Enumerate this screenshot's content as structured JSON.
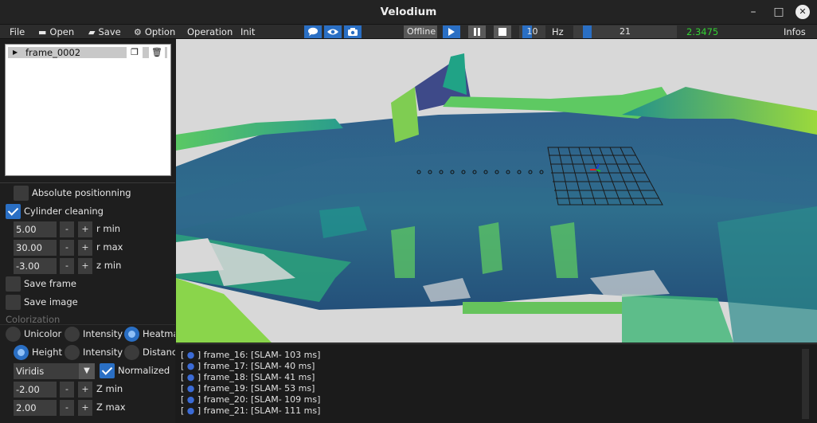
{
  "window": {
    "title": "Velodium",
    "controls": [
      "–",
      "□",
      "✕"
    ]
  },
  "menu": {
    "file": "File",
    "open": "Open",
    "save": "Save",
    "option": "Option",
    "operation": "Operation",
    "init": "Init",
    "offline": "Offline",
    "hz_value": "10",
    "hz_label": "Hz",
    "frame_index": "21",
    "time_value": "2.3475",
    "infos": "Infos"
  },
  "frames": [
    {
      "name": "frame_0002"
    }
  ],
  "options": {
    "absolute_positioning": {
      "label": "Absolute positionning",
      "checked": false
    },
    "cylinder_cleaning": {
      "label": "Cylinder cleaning",
      "checked": true
    },
    "r_min": {
      "value": "5.00",
      "label": "r min"
    },
    "r_max": {
      "value": "30.00",
      "label": "r max"
    },
    "z_min": {
      "value": "-3.00",
      "label": "z min"
    },
    "save_frame": {
      "label": "Save frame",
      "checked": false
    },
    "save_image": {
      "label": "Save image",
      "checked": false
    }
  },
  "colorization": {
    "section": "Colorization",
    "modes": [
      "Unicolor",
      "Intensity",
      "Heatma"
    ],
    "mode_selected": "Heatma",
    "heatmap_modes": [
      "Height",
      "Intensity",
      "Distance"
    ],
    "heatmap_selected": "Height",
    "colormap": "Viridis",
    "normalized": {
      "label": "Normalized",
      "checked": true
    },
    "z_min": {
      "value": "-2.00",
      "label": "Z min"
    },
    "z_max": {
      "value": "2.00",
      "label": "Z max"
    }
  },
  "console": [
    {
      "frame": "frame_16",
      "text": "[SLAM- 103 ms]"
    },
    {
      "frame": "frame_17",
      "text": "[SLAM- 40 ms]"
    },
    {
      "frame": "frame_18",
      "text": "[SLAM- 41 ms]"
    },
    {
      "frame": "frame_19",
      "text": "[SLAM- 53 ms]"
    },
    {
      "frame": "frame_20",
      "text": "[SLAM- 109 ms]"
    },
    {
      "frame": "frame_21",
      "text": "[SLAM- 111 ms]"
    }
  ],
  "colors": {
    "accent": "#2a6fc4",
    "time_value": "#33d133",
    "viewport_bg": "#d8d8d8"
  }
}
